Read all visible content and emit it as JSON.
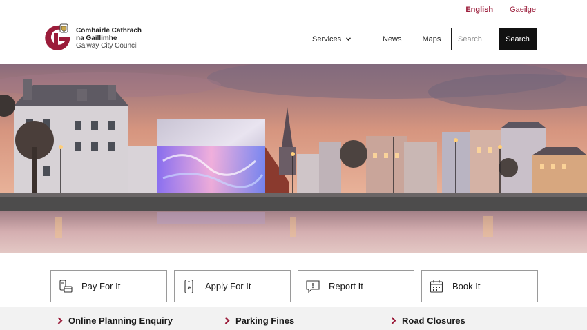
{
  "language": {
    "english": "English",
    "irish": "Gaeilge"
  },
  "logo": {
    "line1": "Comhairle Cathrach",
    "line2": "na Gaillimhe",
    "line3": "Galway City Council"
  },
  "nav": {
    "services": "Services",
    "news": "News",
    "maps": "Maps"
  },
  "search": {
    "placeholder": "Search",
    "button": "Search"
  },
  "quick_links": [
    {
      "label": "Pay For It",
      "icon": "payment-icon"
    },
    {
      "label": "Apply For It",
      "icon": "phone-apply-icon"
    },
    {
      "label": "Report It",
      "icon": "report-message-icon"
    },
    {
      "label": "Book It",
      "icon": "calendar-icon"
    }
  ],
  "bottom_links": [
    {
      "label": "Online Planning Enquiry"
    },
    {
      "label": "Parking Fines"
    },
    {
      "label": "Road Closures"
    }
  ],
  "colors": {
    "brand": "#9b1c3a",
    "dark": "#111111",
    "bottom_bar": "#f2f2f2"
  }
}
